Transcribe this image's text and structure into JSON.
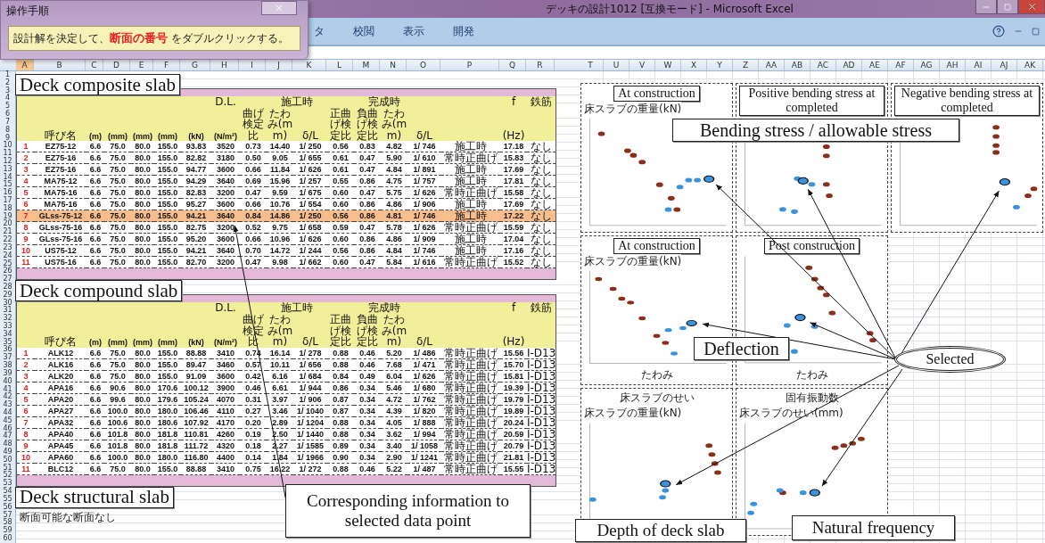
{
  "window": {
    "title": "デッキの設計1012 [互換モード] - Microsoft Excel"
  },
  "popup": {
    "title": "操作手順",
    "message": [
      {
        "text": "設計解を決定して、",
        "emphasis": false
      },
      {
        "text": "断面の番号",
        "emphasis": true
      },
      {
        "text": " をダブルクリックする。",
        "emphasis": false
      }
    ]
  },
  "ribbon": {
    "tabs": [
      "タ",
      "校閲",
      "表示",
      "開発"
    ]
  },
  "columns_left": [
    "A",
    "B",
    "C",
    "D",
    "E",
    "F",
    "G",
    "H",
    "I",
    "J",
    "K",
    "L",
    "M",
    "N",
    "O",
    "P",
    "Q",
    "R"
  ],
  "columns_right": [
    "T",
    "U",
    "V",
    "W",
    "X",
    "Y",
    "Z",
    "AA",
    "AB",
    "AC",
    "AD",
    "AE",
    "AF",
    "AG",
    "AH",
    "AI",
    "AJ",
    "AK"
  ],
  "row_numbers": [
    "1",
    "2",
    "3",
    "4",
    "5",
    "6",
    "7",
    "8",
    "9",
    "10",
    "11",
    "12",
    "13",
    "14",
    "15",
    "16",
    "17",
    "18",
    "19",
    "20",
    "21",
    "22",
    "23",
    "24",
    "25",
    "26",
    "27",
    "28",
    "29",
    "30",
    "31",
    "32",
    "33",
    "34",
    "35",
    "36",
    "37",
    "38",
    "39",
    "40",
    "41",
    "42",
    "43",
    "44",
    "45",
    "46",
    "47",
    "48",
    "49",
    "50",
    "51",
    "52",
    "53",
    "54",
    "55",
    "56",
    "57",
    "58",
    "59",
    "60"
  ],
  "section_labels": [
    "Deck composite slab",
    "Deck compound slab",
    "Deck structural slab"
  ],
  "tables": [
    {
      "group_headers": [
        "D.L.",
        "施工時",
        "完成時",
        "f",
        "鉄筋"
      ],
      "headers": [
        "呼び名",
        "(m)",
        "(mm)",
        "(mm)",
        "(mm)",
        "(kN)",
        "(N/m²)",
        "曲げ検定比",
        "たわみ(mm)",
        "δ/L",
        "正曲げ検定比",
        "負曲げ検定比",
        "たわみ(mm)",
        "δ/L",
        "(Hz)"
      ],
      "rows": [
        {
          "selected": false,
          "cells": [
            "1",
            "EZ75-12",
            "6.6",
            "75.0",
            "80.0",
            "155.0",
            "93.83",
            "3520",
            "0.73",
            "14.40",
            "1/ 250",
            "0.56",
            "0.83",
            "4.82",
            "1/ 746",
            "施工時",
            "17.18",
            "なし"
          ]
        },
        {
          "selected": false,
          "cells": [
            "2",
            "EZ75-16",
            "6.6",
            "75.0",
            "80.0",
            "155.0",
            "82.82",
            "3180",
            "0.50",
            "9.05",
            "1/ 655",
            "0.61",
            "0.47",
            "5.90",
            "1/ 610",
            "常時正曲げ",
            "15.83",
            "なし"
          ]
        },
        {
          "selected": false,
          "cells": [
            "3",
            "EZ75-16",
            "6.6",
            "75.0",
            "80.0",
            "155.0",
            "94.77",
            "3600",
            "0.66",
            "11.84",
            "1/ 626",
            "0.61",
            "0.47",
            "4.84",
            "1/ 891",
            "施工時",
            "17.69",
            "なし"
          ]
        },
        {
          "selected": false,
          "cells": [
            "4",
            "MA75-12",
            "6.6",
            "75.0",
            "80.0",
            "155.0",
            "94.29",
            "3640",
            "0.69",
            "15.96",
            "1/ 257",
            "0.55",
            "0.86",
            "4.75",
            "1/ 757",
            "施工時",
            "17.81",
            "なし"
          ]
        },
        {
          "selected": false,
          "cells": [
            "5",
            "MA75-16",
            "6.6",
            "75.0",
            "80.0",
            "155.0",
            "82.83",
            "3200",
            "0.47",
            "9.59",
            "1/ 675",
            "0.60",
            "0.47",
            "5.75",
            "1/ 626",
            "常時正曲げ",
            "15.58",
            "なし"
          ]
        },
        {
          "selected": false,
          "cells": [
            "6",
            "MA75-16",
            "6.6",
            "75.0",
            "80.0",
            "155.0",
            "95.27",
            "3600",
            "0.66",
            "10.76",
            "1/ 554",
            "0.60",
            "0.86",
            "4.86",
            "1/ 906",
            "施工時",
            "17.69",
            "なし"
          ]
        },
        {
          "selected": true,
          "cells": [
            "7",
            "GLss-75-12",
            "6.6",
            "75.0",
            "80.0",
            "155.0",
            "94.21",
            "3640",
            "0.84",
            "14.86",
            "1/ 250",
            "0.56",
            "0.86",
            "4.81",
            "1/ 746",
            "施工時",
            "17.22",
            "なし"
          ]
        },
        {
          "selected": false,
          "cells": [
            "8",
            "GLss-75-16",
            "6.6",
            "75.0",
            "80.0",
            "155.0",
            "82.75",
            "3200",
            "0.52",
            "9.75",
            "1/ 658",
            "0.59",
            "0.47",
            "5.78",
            "1/ 626",
            "常時正曲げ",
            "15.59",
            "なし"
          ]
        },
        {
          "selected": false,
          "cells": [
            "9",
            "GLss-75-16",
            "6.6",
            "75.0",
            "80.0",
            "155.0",
            "95.20",
            "3600",
            "0.66",
            "10.96",
            "1/ 626",
            "0.60",
            "0.86",
            "4.86",
            "1/ 909",
            "施工時",
            "17.04",
            "なし"
          ]
        },
        {
          "selected": false,
          "cells": [
            "10",
            "US75-12",
            "6.6",
            "75.0",
            "80.0",
            "155.0",
            "94.21",
            "3640",
            "0.70",
            "14.72",
            "1/ 244",
            "0.56",
            "0.86",
            "4.84",
            "1/ 746",
            "施工時",
            "17.16",
            "なし"
          ]
        },
        {
          "selected": false,
          "cells": [
            "11",
            "US75-16",
            "6.6",
            "75.0",
            "80.0",
            "155.0",
            "82.70",
            "3200",
            "0.47",
            "9.98",
            "1/ 662",
            "0.60",
            "0.47",
            "5.84",
            "1/ 616",
            "常時正曲げ",
            "15.52",
            "なし"
          ]
        }
      ]
    },
    {
      "group_headers": [
        "D.L.",
        "施工時",
        "完成時",
        "f",
        "鉄筋"
      ],
      "headers": [
        "呼び名",
        "(m)",
        "(mm)",
        "(mm)",
        "(mm)",
        "(kN)",
        "(N/m²)",
        "曲げ検定比",
        "たわみ(mm)",
        "δ/L",
        "正曲げ検定比",
        "負曲げ検定比",
        "たわみ(mm)",
        "δ/L",
        "(Hz)"
      ],
      "rows": [
        {
          "selected": false,
          "cells": [
            "1",
            "ALK12",
            "6.6",
            "75.0",
            "80.0",
            "155.0",
            "88.88",
            "3410",
            "0.74",
            "16.14",
            "1/ 278",
            "0.88",
            "0.46",
            "5.20",
            "1/ 486",
            "常時正曲げ",
            "15.56",
            "I-D13"
          ]
        },
        {
          "selected": false,
          "cells": [
            "2",
            "ALK16",
            "6.6",
            "75.0",
            "80.0",
            "155.0",
            "89.47",
            "3460",
            "0.57",
            "10.11",
            "1/ 656",
            "0.88",
            "0.46",
            "7.68",
            "1/ 471",
            "常時正曲げ",
            "15.70",
            "I-D13"
          ]
        },
        {
          "selected": false,
          "cells": [
            "3",
            "ALK20",
            "6.6",
            "75.0",
            "80.0",
            "155.0",
            "91.09",
            "3600",
            "0.42",
            "6.16",
            "1/ 684",
            "0.84",
            "0.49",
            "6.04",
            "1/ 626",
            "常時正曲げ",
            "15.81",
            "I-D13"
          ]
        },
        {
          "selected": false,
          "cells": [
            "4",
            "APA16",
            "6.6",
            "90.6",
            "80.0",
            "170.6",
            "100.12",
            "3900",
            "0.46",
            "6.61",
            "1/ 944",
            "0.86",
            "0.34",
            "5.46",
            "1/ 680",
            "常時正曲げ",
            "19.39",
            "I-D13"
          ]
        },
        {
          "selected": false,
          "cells": [
            "5",
            "APA20",
            "6.6",
            "99.6",
            "80.0",
            "179.6",
            "105.24",
            "4070",
            "0.31",
            "3.97",
            "1/ 906",
            "0.87",
            "0.34",
            "4.72",
            "1/ 762",
            "常時正曲げ",
            "19.79",
            "I-D13"
          ]
        },
        {
          "selected": false,
          "cells": [
            "6",
            "APA27",
            "6.6",
            "100.0",
            "80.0",
            "180.0",
            "106.46",
            "4110",
            "0.27",
            "3.46",
            "1/ 1040",
            "0.87",
            "0.34",
            "4.39",
            "1/ 820",
            "常時正曲げ",
            "19.89",
            "I-D13"
          ]
        },
        {
          "selected": false,
          "cells": [
            "7",
            "APA32",
            "6.6",
            "100.6",
            "80.0",
            "180.6",
            "107.92",
            "4170",
            "0.20",
            "2.89",
            "1/ 1204",
            "0.88",
            "0.34",
            "4.05",
            "1/ 888",
            "常時正曲げ",
            "20.24",
            "I-D13"
          ]
        },
        {
          "selected": false,
          "cells": [
            "8",
            "APA40",
            "6.6",
            "101.8",
            "80.0",
            "181.8",
            "110.81",
            "4260",
            "0.19",
            "2.50",
            "1/ 1440",
            "0.88",
            "0.34",
            "3.62",
            "1/ 994",
            "常時正曲げ",
            "20.59",
            "I-D13"
          ]
        },
        {
          "selected": false,
          "cells": [
            "9",
            "APA45",
            "6.6",
            "101.8",
            "80.0",
            "181.8",
            "111.72",
            "4320",
            "0.18",
            "2.27",
            "1/ 1585",
            "0.89",
            "0.34",
            "3.40",
            "1/ 1058",
            "常時正曲げ",
            "20.79",
            "I-D13"
          ]
        },
        {
          "selected": false,
          "cells": [
            "10",
            "APA60",
            "6.6",
            "100.0",
            "80.0",
            "180.0",
            "116.80",
            "4400",
            "0.14",
            "1.84",
            "1/ 1966",
            "0.90",
            "0.34",
            "2.90",
            "1/ 1241",
            "常時正曲げ",
            "21.81",
            "I-D13"
          ]
        },
        {
          "selected": false,
          "cells": [
            "11",
            "BLC12",
            "6.6",
            "75.0",
            "80.0",
            "155.0",
            "88.88",
            "3410",
            "0.75",
            "16.22",
            "1/ 272",
            "0.88",
            "0.46",
            "5.22",
            "1/ 487",
            "常時正曲げ",
            "15.55",
            "I-D13"
          ]
        }
      ]
    }
  ],
  "note": "断面可能な断面なし",
  "chart_rows": [
    [
      {
        "caption": "At construction",
        "ylabel": "床スラブの重量(kN)"
      },
      {
        "caption": "Positive bending stress at completed"
      },
      {
        "caption": "Negative bending stress at completed"
      }
    ],
    [
      {
        "caption": "At construction",
        "ylabel": "床スラブの重量(kN)",
        "xlabel": "たわみ"
      },
      {
        "caption": "Post construction",
        "xlabel": "たわみ"
      }
    ],
    [
      {
        "title": "床スラブのせい",
        "ylabel": "床スラブの重量(kN)"
      },
      {
        "title": "固有振動数",
        "ylabel": "床スラブのせい(mm)"
      }
    ]
  ],
  "annotations": [
    {
      "text": "Bending stress / allowable stress"
    },
    {
      "text": "Deflection"
    },
    {
      "text": "Corresponding information to selected data point"
    },
    {
      "text": "Selected"
    },
    {
      "text": "Depth of deck slab"
    },
    {
      "text": "Natural frequency"
    }
  ]
}
